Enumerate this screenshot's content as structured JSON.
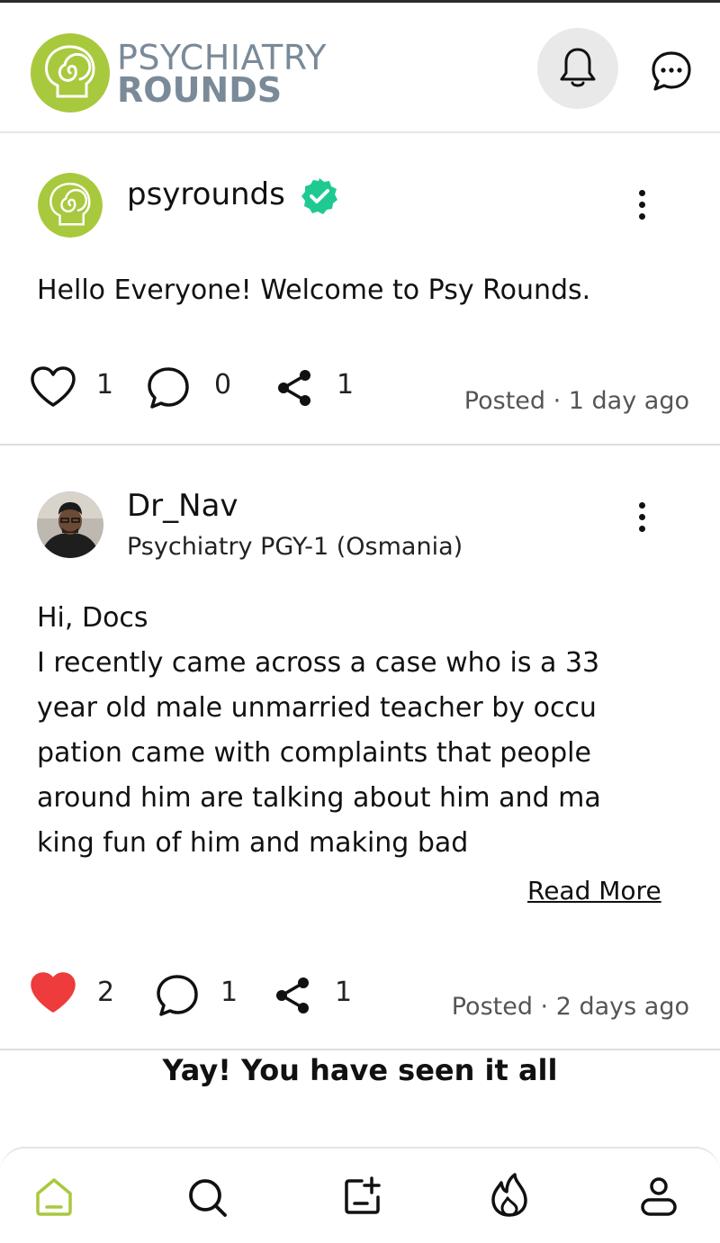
{
  "app": {
    "brand_line1": "PSYCHIATRY",
    "brand_line2": "ROUNDS",
    "accent_color": "#a8c93d",
    "verified_color": "#1fc992",
    "like_active_color": "#ee3b3b"
  },
  "header": {
    "notification_icon": "bell-icon",
    "messages_icon": "chat-bubble-icon"
  },
  "posts": [
    {
      "username": "psyrounds",
      "verified": true,
      "subtitle": "",
      "body": "Hello Everyone! Welcome to Psy Rounds.",
      "likes": "1",
      "liked": false,
      "comments": "0",
      "shares": "1",
      "posted": "Posted · 1 day ago"
    },
    {
      "username": "Dr_Nav",
      "verified": false,
      "subtitle": "Psychiatry PGY-1 (Osmania)",
      "body_lines": [
        "Hi, Docs",
        "I recently came across a case who is a 33",
        "year old male unmarried teacher by occu",
        "pation came with complaints that people",
        "around him are talking about him and ma",
        "king fun of him and making bad"
      ],
      "read_more": "Read More",
      "likes": "2",
      "liked": true,
      "comments": "1",
      "shares": "1",
      "posted": "Posted · 2 days ago"
    }
  ],
  "feed_end_message": "Yay! You have seen it all",
  "bottom_nav": [
    {
      "name": "home",
      "icon": "home-icon",
      "active": true
    },
    {
      "name": "search",
      "icon": "search-icon",
      "active": false
    },
    {
      "name": "create",
      "icon": "add-post-icon",
      "active": false
    },
    {
      "name": "trending",
      "icon": "flame-icon",
      "active": false
    },
    {
      "name": "profile",
      "icon": "user-icon",
      "active": false
    }
  ]
}
